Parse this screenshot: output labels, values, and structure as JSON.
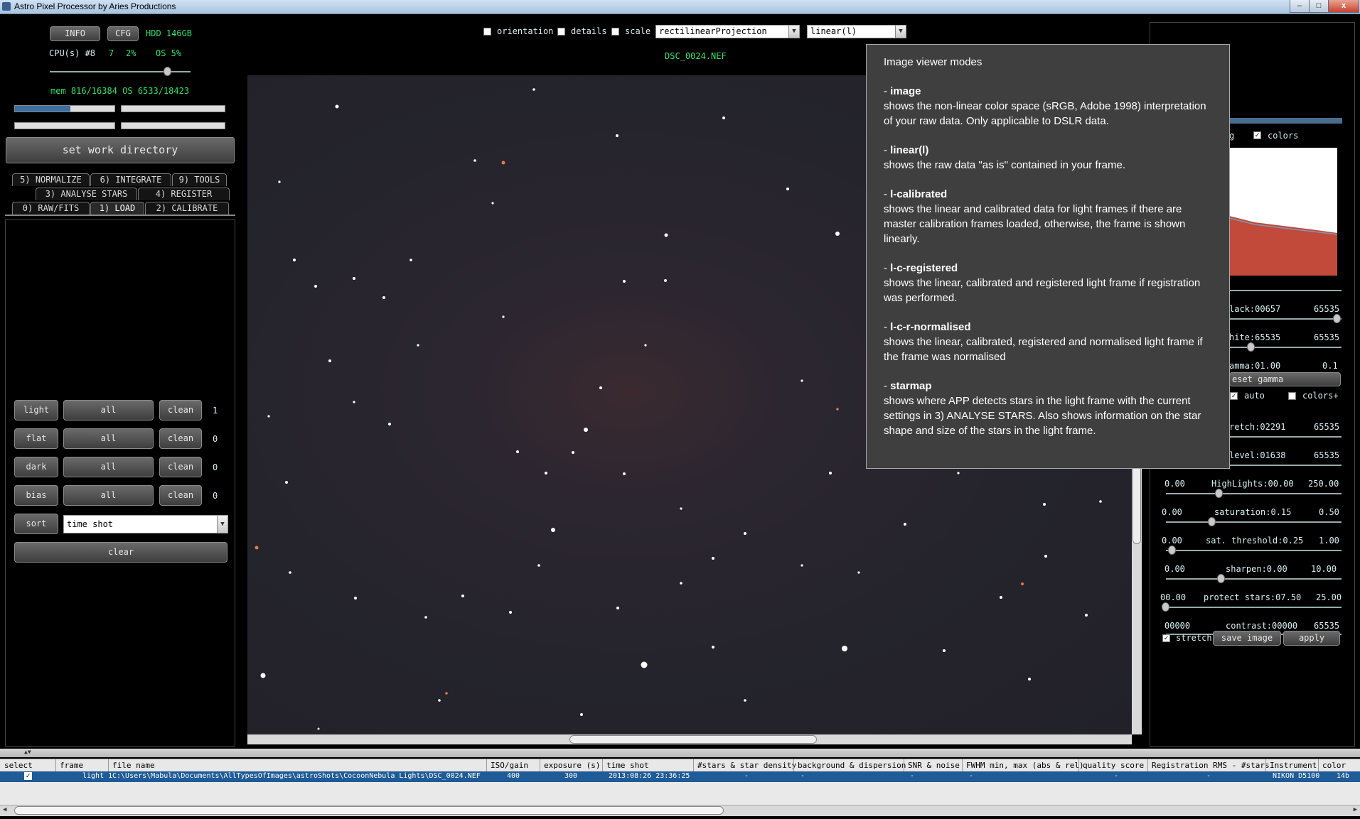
{
  "window": {
    "title": "Astro Pixel Processor by  Aries Productions",
    "minimize": "–",
    "maximize": "□",
    "close": "x"
  },
  "topleft": {
    "info_btn": "INFO",
    "cfg_btn": "CFG",
    "hdd": "HDD 146GB",
    "cpu": "CPU(s) #8",
    "cpu_n": "7",
    "cpu_pct": "2%",
    "os_pct": "OS 5%",
    "mem": "mem 816/16384  OS 6533/18423",
    "work_dir_btn": "set work directory"
  },
  "tabs": {
    "row1": [
      "5) NORMALIZE",
      "6) INTEGRATE",
      "9) TOOLS"
    ],
    "row2": [
      "3) ANALYSE STARS",
      "4) REGISTER"
    ],
    "row3": [
      "0) RAW/FITS",
      "1) LOAD",
      "2) CALIBRATE"
    ]
  },
  "load": {
    "rows": [
      {
        "type": "light",
        "all": "all",
        "clean": "clean",
        "count": "1"
      },
      {
        "type": "flat",
        "all": "all",
        "clean": "clean",
        "count": "0"
      },
      {
        "type": "dark",
        "all": "all",
        "clean": "clean",
        "count": "0"
      },
      {
        "type": "bias",
        "all": "all",
        "clean": "clean",
        "count": "0"
      }
    ],
    "sort_btn": "sort",
    "sort_value": "time shot",
    "clear_btn": "clear"
  },
  "viewer": {
    "orientation": "orientation",
    "details": "details",
    "scale": "scale",
    "projection": "rectilinearProjection",
    "mode": "linear(l)",
    "filename": "DSC_0024.NEF"
  },
  "tooltip": {
    "heading": "Image viewer modes",
    "items": [
      {
        "name": "image",
        "desc": "shows the non-linear color space (sRGB, Adobe 1998) interpretation of your raw data. Only applicable to DSLR data."
      },
      {
        "name": "linear(l)",
        "desc": "shows the raw data \"as is\" contained in your frame."
      },
      {
        "name": "l-calibrated",
        "desc": "shows the linear and calibrated data for light frames if there are master calibration frames loaded, otherwise, the frame is shown linearly."
      },
      {
        "name": "l-c-registered",
        "desc": "shows the linear, calibrated and registered light frame if registration was performed."
      },
      {
        "name": "l-c-r-normalised",
        "desc": "shows the linear, calibrated, registered and normalised light frame if the frame was normalised"
      },
      {
        "name": "starmap",
        "desc": "shows where APP detects stars in the light frame with the current settings in 3) ANALYSE STARS. Also shows information on the star shape and size of the stars in the light frame."
      }
    ]
  },
  "rightpanel": {
    "log_partial": "g",
    "colors": "colors",
    "black": "lack:00657",
    "black_max": "65535",
    "white": "hite:65535",
    "white_max": "65535",
    "gamma": "amma:01.00",
    "gamma_max": "0.1",
    "reset_gamma": "eset gamma",
    "auto": "auto",
    "colors_plus": "colors+",
    "stretch": "retch:02291",
    "stretch_max": "65535",
    "level": "level:01638",
    "level_max": "65535",
    "highlights_min": "0.00",
    "highlights": "HighLights:00.00",
    "highlights_max": "250.00",
    "saturation_min": "0.00",
    "saturation": "saturation:0.15",
    "saturation_max": "0.50",
    "satthr_min": "0.00",
    "satthr": "sat. threshold:0.25",
    "satthr_max": "1.00",
    "sharpen_min": "0.00",
    "sharpen": "sharpen:0.00",
    "sharpen_max": "10.00",
    "protect_min": "00.00",
    "protect": "protect stars:07.50",
    "protect_max": "25.00",
    "contrast_min": "00000",
    "contrast": "contrast:00000",
    "contrast_max": "65535",
    "stretch_chk": "stretch",
    "save_image": "save image",
    "apply": "apply"
  },
  "table": {
    "columns": [
      "select",
      "frame",
      "file name",
      "ISO/gain",
      "exposure (s)",
      "time shot",
      "#stars & star density",
      "background & dispersion",
      "SNR & noise",
      "FWHM min, max (abs & rel)",
      "quality score",
      "Registration RMS - #stars",
      "Instrument",
      "color"
    ],
    "row": {
      "select": "✓",
      "frame": "light 1",
      "file": "C:\\Users\\Mabula\\Documents\\AllTypesOfImages\\astroShots\\CocoonNebula Lights\\DSC_0024.NEF",
      "iso": "400",
      "exposure": "300",
      "time": "2013:08:26 23:36:25",
      "stars": "-",
      "bg": "-",
      "snr": "-",
      "fwhm": "-",
      "quality": "-",
      "rms": "-",
      "instrument": "NIKON D5100",
      "color": "14b"
    }
  },
  "colors": {
    "accent_green": "#36e06a",
    "selected_row": "#1f5b96",
    "tooltip_bg": "#3f3f3f"
  }
}
